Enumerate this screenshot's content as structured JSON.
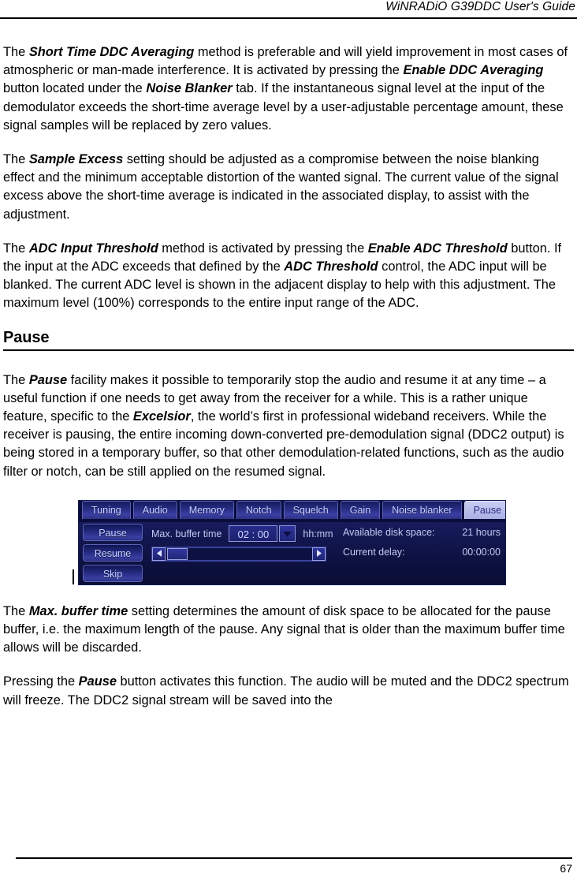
{
  "header": {
    "title": "WiNRADiO G39DDC User's Guide"
  },
  "body": {
    "p1": {
      "a": "The ",
      "t1": "Short Time DDC Averaging",
      "b": " method is preferable and will yield improvement in most cases of atmospheric or man-made interference. It is activated by pressing the ",
      "t2": "Enable DDC Averaging",
      "c": " button located under the ",
      "t3": "Noise Blanker",
      "d": " tab. If the instantaneous signal level at the input of the demodulator exceeds the short-time average level by a user-adjustable percentage amount, these signal samples will be replaced by zero values."
    },
    "p2": {
      "a": "The ",
      "t1": "Sample Excess",
      "b": " setting should be adjusted as a compromise between the noise blanking effect and the minimum acceptable distortion of the wanted signal. The current value of the signal excess above the short-time average is indicated in the associated display, to assist with the adjustment."
    },
    "p3": {
      "a": "The ",
      "t1": "ADC Input Threshold",
      "b": " method is activated by pressing the ",
      "t2": "Enable ADC Threshold",
      "c": " button. If the input at the ADC exceeds that defined by the ",
      "t3": "ADC Threshold",
      "d": " control, the ADC input will be blanked. The current ADC level is shown in the adjacent display to help with this adjustment. The maximum level (100%) corresponds to the entire input range of the ADC."
    },
    "heading": "Pause",
    "p4": {
      "a": "The ",
      "t1": "Pause",
      "b": " facility makes it possible to temporarily stop the audio and resume it at any time – a useful function if one needs to get away from the receiver for a while. This is a rather unique feature, specific to the ",
      "t2": "Excelsior",
      "c": ", the world’s first in professional wideband receivers. While the receiver is pausing, the entire incoming down-converted pre-demodulation signal (DDC2 output) is being stored in a temporary buffer, so that other demodulation-related functions, such as the audio filter or notch, can be still applied on the resumed signal."
    },
    "p5": {
      "a": "The ",
      "t1": "Max. buffer time",
      "b": " setting determines the amount of disk space to be allocated for the pause buffer, i.e. the maximum length of the pause. Any signal that is older than the maximum buffer time allows will be discarded."
    },
    "p6": {
      "a": "Pressing the ",
      "t1": "Pause",
      "b": " button activates this function. The audio will be muted and the DDC2 spectrum will freeze. The DDC2 signal stream will be saved into the"
    }
  },
  "figure": {
    "tabs": [
      {
        "label": "Tuning",
        "active": false
      },
      {
        "label": "Audio",
        "active": false
      },
      {
        "label": "Memory",
        "active": false
      },
      {
        "label": "Notch",
        "active": false
      },
      {
        "label": "Squelch",
        "active": false
      },
      {
        "label": "Gain",
        "active": false
      },
      {
        "label": "Noise blanker",
        "active": false
      },
      {
        "label": "Pause",
        "active": true
      }
    ],
    "buttons": [
      {
        "label": "Pause"
      },
      {
        "label": "Resume"
      },
      {
        "label": "Skip"
      }
    ],
    "buffer": {
      "label": "Max. buffer time",
      "value": "02 : 00",
      "unit": "hh:mm"
    },
    "status": [
      {
        "label": "Available disk space:",
        "value": "21 hours"
      },
      {
        "label": "Current delay:",
        "value": "00:00:00"
      }
    ],
    "colors": {
      "panel_bg": "#0a0d3c",
      "tab_text": "#c8d2ff",
      "active_tab_bg": "#c9cdf2",
      "active_tab_text": "#2a2f86",
      "border": "#5a62b8"
    }
  },
  "footer": {
    "page_number": "67"
  }
}
